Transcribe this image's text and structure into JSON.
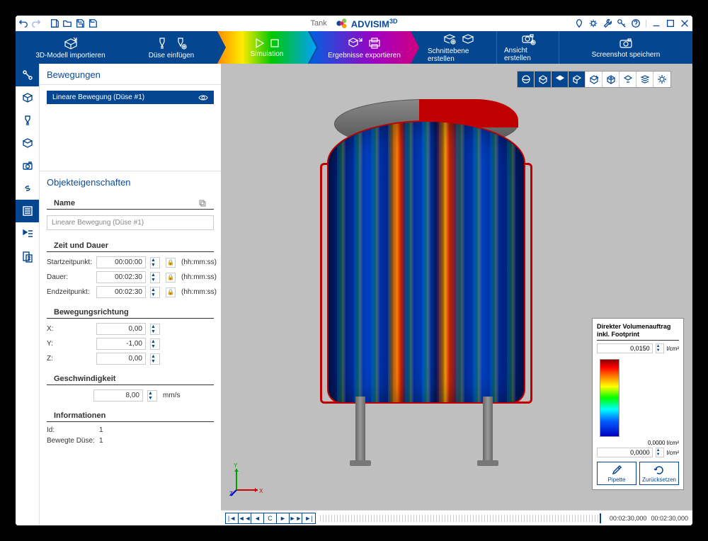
{
  "titlebar": {
    "doc": "Tank",
    "brand": "ADVISIM",
    "brand_sup": "3D"
  },
  "ribbon": {
    "import": "3D-Modell importieren",
    "nozzle": "Düse einfügen",
    "simulation": "Simulation",
    "export": "Ergebnisse exportieren",
    "clip": "Schnittebene erstellen",
    "view": "Ansicht erstellen",
    "screenshot": "Screenshot speichern"
  },
  "panel": {
    "bewegungen": "Bewegungen",
    "row1": "Lineare Bewegung (Düse #1)",
    "objekt": "Objekteigenschaften",
    "name_label": "Name",
    "name_value": "Lineare Bewegung (Düse #1)",
    "zeit_label": "Zeit und Dauer",
    "start_label": "Startzeitpunkt:",
    "start_value": "00:00:00",
    "dauer_label": "Dauer:",
    "dauer_value": "00:02:30",
    "end_label": "Endzeitpunkt:",
    "end_value": "00:02:30",
    "hhmmss": "(hh:mm:ss)",
    "richtung_label": "Bewegungsrichtung",
    "x_label": "X:",
    "x_value": "0,00",
    "y_label": "Y:",
    "y_value": "-1,00",
    "z_label": "Z:",
    "z_value": "0,00",
    "speed_label": "Geschwindigkeit",
    "speed_value": "8,00",
    "speed_unit": "mm/s",
    "info_label": "Informationen",
    "id_label": "Id:",
    "id_value": "1",
    "moved_label": "Bewegte Düse:",
    "moved_value": "1"
  },
  "legend": {
    "title1": "Direkter Volumenauftrag",
    "title2": "inkl. Footprint",
    "max": "0,0150",
    "min_label": "0,0000 l/cm²",
    "min": "0,0000",
    "unit": "l/cm²",
    "pipette": "Pipette",
    "reset": "Zurücksetzen"
  },
  "playbar": {
    "t1": "00:02:30,000",
    "t2": "00:02:30,000"
  },
  "axis": {
    "x": "X",
    "y": "Y",
    "z": "Z"
  }
}
